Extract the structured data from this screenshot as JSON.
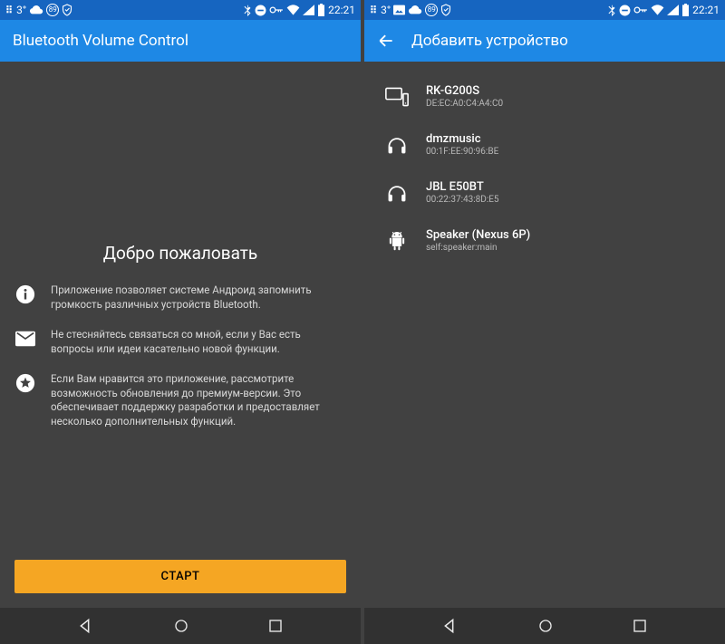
{
  "left": {
    "status": {
      "temp": "3°",
      "badge": "89",
      "time": "22:21"
    },
    "app_bar": {
      "title": "Bluetooth Volume Control"
    },
    "welcome": {
      "title": "Добро пожаловать",
      "info_text": "Приложение позволяет системе Андроид запомнить громкость различных устройств Bluetooth.",
      "mail_text": "Не стесняйтесь связаться со мной, если у Вас есть вопросы или идеи касательно новой функции.",
      "star_text": "Если Вам нравится это приложение, рассмотрите возможность обновления до премиум-версии. Это обеспечивает поддержку разработки и предоставляет несколько дополнительных функций."
    },
    "start_label": "СТАРТ"
  },
  "right": {
    "status": {
      "temp": "3°",
      "badge": "89",
      "time": "22:21"
    },
    "app_bar": {
      "title": "Добавить устройство"
    },
    "devices": [
      {
        "name": "RK-G200S",
        "sub": "DE:EC:A0:C4:A4:C0",
        "icon": "display"
      },
      {
        "name": "dmzmusic",
        "sub": "00:1F:EE:90:96:BE",
        "icon": "headphones"
      },
      {
        "name": "JBL E50BT",
        "sub": "00:22:37:43:8D:E5",
        "icon": "headphones"
      },
      {
        "name": "Speaker (Nexus 6P)",
        "sub": "self:speaker:main",
        "icon": "android"
      }
    ]
  }
}
